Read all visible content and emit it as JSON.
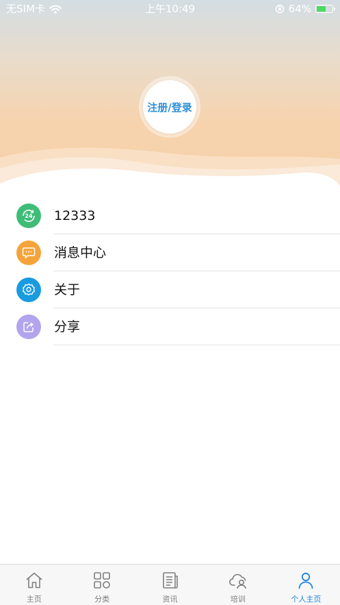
{
  "status_bar": {
    "carrier": "无SIM卡",
    "time": "上午10:49",
    "battery_percent": "64%",
    "battery_level": 0.64,
    "wifi_icon": "wifi-icon",
    "rotation_lock_icon": "rotation-lock-icon"
  },
  "header": {
    "login_label": "注册/登录",
    "gradient_top": "#d3dde3",
    "gradient_bottom": "#f7d2ab"
  },
  "menu": {
    "items": [
      {
        "label": "12333",
        "icon": "service-24h-icon",
        "color": "#3fbd78"
      },
      {
        "label": "消息中心",
        "icon": "message-icon",
        "color": "#f4a43a"
      },
      {
        "label": "关于",
        "icon": "gear-icon",
        "color": "#1a9be0"
      },
      {
        "label": "分享",
        "icon": "share-icon",
        "color": "#b3a4ee"
      }
    ]
  },
  "tab_bar": {
    "active_color": "#1e82dc",
    "inactive_color": "#7d7d7d",
    "tabs": [
      {
        "label": "主页",
        "icon": "home-icon",
        "active": false
      },
      {
        "label": "分类",
        "icon": "category-grid-icon",
        "active": false
      },
      {
        "label": "资讯",
        "icon": "news-icon",
        "active": false
      },
      {
        "label": "培训",
        "icon": "training-cloud-icon",
        "active": false
      },
      {
        "label": "个人主页",
        "icon": "person-icon",
        "active": true
      }
    ]
  }
}
